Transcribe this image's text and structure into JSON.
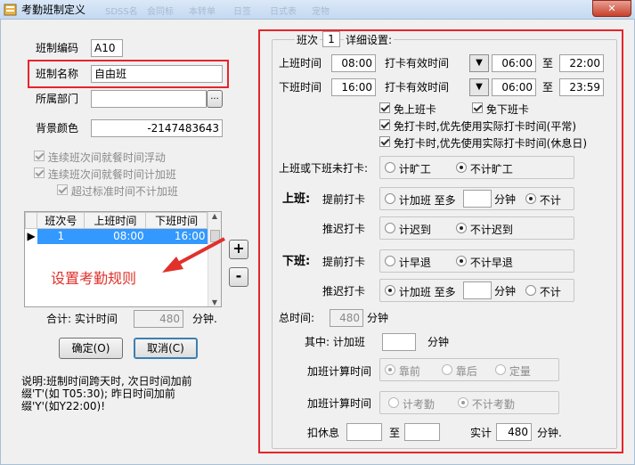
{
  "window": {
    "title": "考勤班制定义",
    "ghost_tabs": [
      "SDSS名",
      "会同标",
      "本转单",
      "日签",
      "日式表",
      "宠物"
    ],
    "close_glyph": "✕"
  },
  "left": {
    "code_label": "班制编码",
    "code_value": "A10",
    "name_label": "班制名称",
    "name_value": "自由班",
    "dept_label": "所属部门",
    "dept_value": "",
    "dept_browse": "...",
    "bg_label": "背景颜色",
    "bg_value": "-2147483643",
    "check_float": "连续班次间就餐时间浮动",
    "check_overtime": "连续班次间就餐时间计加班",
    "check_exceed": "超过标准时间不计加班",
    "table": {
      "headers": [
        "班次号",
        "上班时间",
        "下班时间"
      ],
      "rows": [
        {
          "no": "1",
          "start": "08:00",
          "end": "16:00"
        }
      ]
    },
    "add_btn": "+",
    "remove_btn": "-",
    "annotation": "设置考勤规则",
    "total_label": "合计:  实计时间",
    "total_value": "480",
    "total_unit": "分钟.",
    "ok_btn": "确定(O)",
    "cancel_btn": "取消(C)",
    "note_line1": "说明:班制时间跨天时, 次日时间加前",
    "note_line2": "缀'T'(如 T05:30);  昨日时间加前",
    "note_line3": "缀'Y'(如Y22:00)!"
  },
  "right": {
    "shift_label": "班次",
    "shift_no": "1",
    "detail_label": "详细设置:",
    "on_label": "上班时间",
    "on_value": "08:00",
    "card_valid_label": "打卡有效时间",
    "on_from": "06:00",
    "to_label": "至",
    "on_to": "22:00",
    "off_label": "下班时间",
    "off_value": "16:00",
    "off_from": "06:00",
    "off_to": "23:59",
    "free_on": "免上班卡",
    "free_off": "免下班卡",
    "free_actual_normal": "免打卡时,优先使用实际打卡时间(平常)",
    "free_actual_rest": "免打卡时,优先使用实际打卡时间(休息日)",
    "miss_label": "上班或下班未打卡:",
    "miss_opt1": "计旷工",
    "miss_opt2": "不计旷工",
    "work_on": "上班:",
    "early_card": "提前打卡",
    "early_opt1": "计加班 至多",
    "minute": "分钟",
    "not_count": "不计",
    "late_card": "推迟打卡",
    "late_opt1": "计迟到",
    "late_opt2": "不计迟到",
    "work_off": "下班:",
    "off_early_opt1": "计早退",
    "off_early_opt2": "不计早退",
    "total_time_label": "总时间:",
    "total_time_value": "480",
    "total_time_unit": "分钟",
    "of_which": "其中: 计加班",
    "of_which_unit": "分钟",
    "ot_calc_label": "加班计算时间",
    "ot_opt1": "靠前",
    "ot_opt2": "靠后",
    "ot_opt3": "定量",
    "ot_att_label": "加班计算时间",
    "ot_att1": "计考勤",
    "ot_att2": "不计考勤",
    "break_label": "扣休息",
    "break_to": "至",
    "actual_label": "实计",
    "actual_value": "480",
    "actual_unit": "分钟."
  },
  "colors": {
    "highlight": "#e8242a",
    "selection": "#3399ff"
  }
}
